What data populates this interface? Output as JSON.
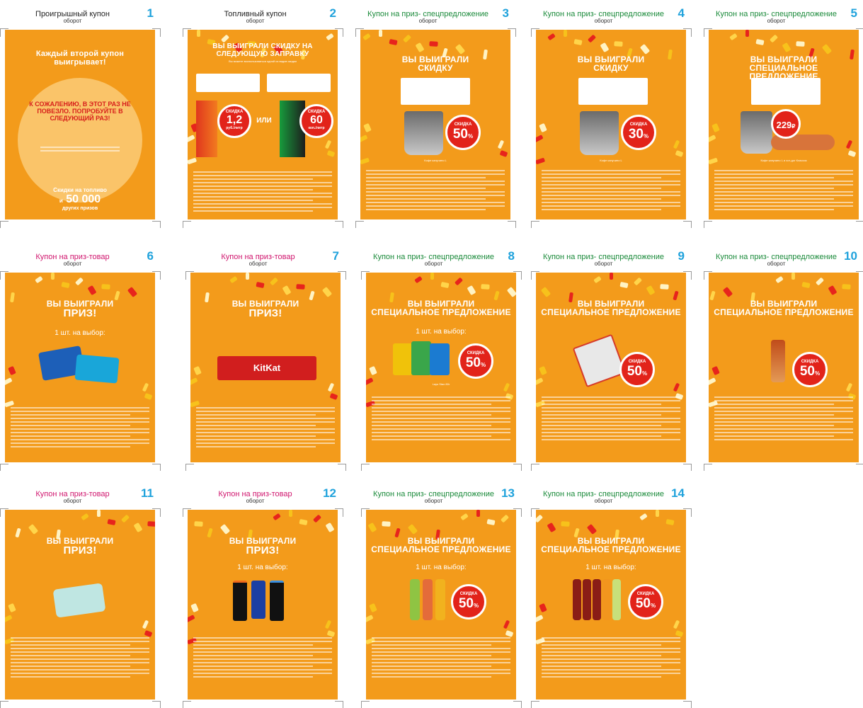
{
  "cells": [
    {
      "title": "Проигрышный купон",
      "color": "black",
      "num": "1",
      "sub": "оборот"
    },
    {
      "title": "Топливный купон",
      "color": "black",
      "num": "2",
      "sub": "оборот"
    },
    {
      "title": "Купон на приз- спецпредложение",
      "color": "green",
      "num": "3",
      "sub": "оборот"
    },
    {
      "title": "Купон на приз- спецпредложение",
      "color": "green",
      "num": "4",
      "sub": "оборот"
    },
    {
      "title": "Купон на приз- спецпредложение",
      "color": "green",
      "num": "5",
      "sub": "оборот"
    },
    {
      "title": "Купон на приз-товар",
      "color": "pink",
      "num": "6",
      "sub": "оборот"
    },
    {
      "title": "Купон на приз-товар",
      "color": "pink",
      "num": "7",
      "sub": "оборот"
    },
    {
      "title": "Купон на приз- спецпредложение",
      "color": "green",
      "num": "8",
      "sub": "оборот"
    },
    {
      "title": "Купон на приз- спецпредложение",
      "color": "green",
      "num": "9",
      "sub": "оборот"
    },
    {
      "title": "Купон на приз- спецпредложение",
      "color": "green",
      "num": "10",
      "sub": "оборот"
    },
    {
      "title": "Купон на приз-товар",
      "color": "pink",
      "num": "11",
      "sub": "оборот"
    },
    {
      "title": "Купон на приз-товар",
      "color": "pink",
      "num": "12",
      "sub": "оборот"
    },
    {
      "title": "Купон на приз- спецпредложение",
      "color": "green",
      "num": "13",
      "sub": "оборот"
    },
    {
      "title": "Купон на приз- спецпредложение",
      "color": "green",
      "num": "14",
      "sub": "оборот"
    }
  ],
  "card1": {
    "head": "Каждый второй купон выигрывает!",
    "red": "К СОЖАЛЕНИЮ, В ЭТОТ РАЗ НЕ ПОВЕЗЛО. ПОПРОБУЙТЕ В СЛЕДУЮЩИЙ РАЗ!",
    "bottom": "Скидки на топливо",
    "big_num": "50 000",
    "and": "и",
    "other": "других призов"
  },
  "card2": {
    "head": "ВЫ ВЫИГРАЛИ СКИДКУ НА СЛЕДУЮЩУЮ ЗАПРАВКУ",
    "sub": "Вы можете воспользоваться одной из видов скидки",
    "badge1_label": "СКИДКА",
    "badge1_value": "1,2",
    "badge1_unit": "руб./литр",
    "or": "ИЛИ",
    "badge2_label": "СКИДКА",
    "badge2_value": "60",
    "badge2_unit": "коп./литр"
  },
  "card3": {
    "head": "ВЫ ВЫИГРАЛИ СКИДКУ",
    "badge_label": "СКИДКА",
    "badge_value": "50",
    "badge_unit": "%",
    "caption": "Кофе капучино L"
  },
  "card4": {
    "head": "ВЫ ВЫИГРАЛИ СКИДКУ",
    "badge_label": "СКИДКА",
    "badge_value": "30",
    "badge_unit": "%",
    "caption": "Кофе капучино L"
  },
  "card5": {
    "head": "ВЫ ВЫИГРАЛИ СПЕЦИАЛЬНОЕ ПРЕДЛОЖЕНИЕ",
    "badge_value": "229",
    "badge_unit": "₽",
    "caption": "Кофе капучино L и хот-дог Классик"
  },
  "card6": {
    "head1": "ВЫ ВЫИГРАЛИ",
    "head2": "ПРИЗ!",
    "choose": "1 шт. на выбор:"
  },
  "card7": {
    "head1": "ВЫ ВЫИГРАЛИ",
    "head2": "ПРИЗ!",
    "brand": "KitKat"
  },
  "card8": {
    "head1": "ВЫ ВЫИГРАЛИ",
    "head2": "СПЕЦИАЛЬНОЕ ПРЕДЛОЖЕНИЕ",
    "choose": "1 шт. на выбор:",
    "badge_label": "СКИДКА",
    "badge_value": "50",
    "badge_unit": "%",
    "caption": "Lays Stax 80г"
  },
  "card9": {
    "head1": "ВЫ ВЫИГРАЛИ",
    "head2": "СПЕЦИАЛЬНОЕ ПРЕДЛОЖЕНИЕ",
    "badge_label": "СКИДКА",
    "badge_value": "50",
    "badge_unit": "%"
  },
  "card10": {
    "head1": "ВЫ ВЫИГРАЛИ",
    "head2": "СПЕЦИАЛЬНОЕ ПРЕДЛОЖЕНИЕ",
    "badge_label": "СКИДКА",
    "badge_value": "50",
    "badge_unit": "%"
  },
  "card11": {
    "head1": "ВЫ ВЫИГРАЛИ",
    "head2": "ПРИЗ!"
  },
  "card12": {
    "head1": "ВЫ ВЫИГРАЛИ",
    "head2": "ПРИЗ!",
    "choose": "1 шт. на выбор:"
  },
  "card13": {
    "head1": "ВЫ ВЫИГРАЛИ",
    "head2": "СПЕЦИАЛЬНОЕ ПРЕДЛОЖЕНИЕ",
    "choose": "1 шт. на выбор:",
    "badge_label": "СКИДКА",
    "badge_value": "50",
    "badge_unit": "%"
  },
  "card14": {
    "head1": "ВЫ ВЫИГРАЛИ",
    "head2": "СПЕЦИАЛЬНОЕ ПРЕДЛОЖЕНИЕ",
    "choose": "1 шт. на выбор:",
    "badge_label": "СКИДКА",
    "badge_value": "50",
    "badge_unit": "%"
  },
  "colors": {
    "card": "#f39b1b",
    "badge": "#e2231a",
    "number": "#1fa2dc",
    "green_title": "#1a8a3a",
    "pink_title": "#d0166e"
  }
}
